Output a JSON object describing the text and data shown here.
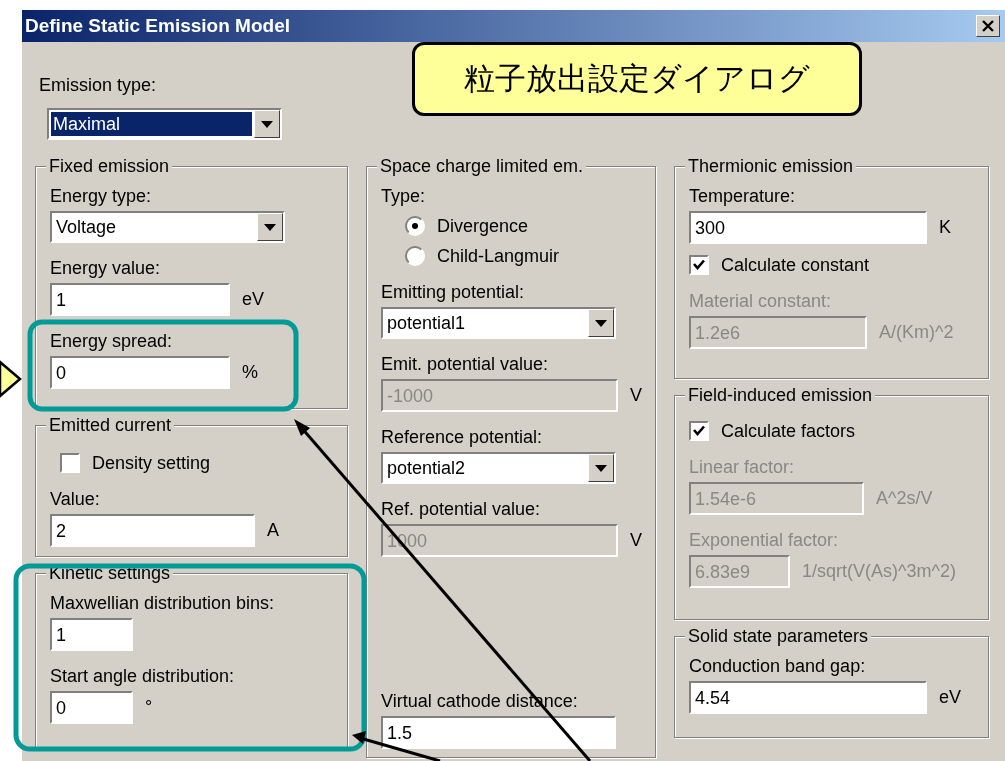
{
  "window": {
    "title": "Define Static Emission Model"
  },
  "emission_type": {
    "label": "Emission type:",
    "value": "Maximal",
    "highlighted": true
  },
  "columns": [
    [
      {
        "title": "Fixed emission",
        "items": [
          {
            "kind": "label",
            "text": "Energy type:",
            "disabled": false
          },
          {
            "kind": "select",
            "value": "Voltage",
            "highlighted": false
          },
          {
            "kind": "label",
            "text": "Energy value:",
            "disabled": false
          },
          {
            "kind": "input",
            "value": "1",
            "disabled": false,
            "unit": {
              "text": "eV",
              "disabled": false
            }
          },
          {
            "kind": "label",
            "text": "Energy spread:",
            "disabled": false
          },
          {
            "kind": "input",
            "value": "0",
            "disabled": false,
            "unit": {
              "text": "%",
              "disabled": false
            }
          }
        ]
      },
      {
        "title": "Emitted current",
        "items": [
          {
            "kind": "checkbox",
            "label": "Density setting",
            "checked": false
          },
          {
            "kind": "label",
            "text": "Value:",
            "disabled": false
          },
          {
            "kind": "input",
            "value": "2",
            "disabled": false,
            "unit": {
              "text": "A",
              "disabled": false
            }
          }
        ]
      },
      {
        "title": "Kinetic settings",
        "items": [
          {
            "kind": "label",
            "text": "Maxwellian distribution bins:",
            "disabled": false
          },
          {
            "kind": "input",
            "value": "1",
            "disabled": false
          },
          {
            "kind": "label",
            "text": "Start angle distribution:",
            "disabled": false
          },
          {
            "kind": "input",
            "value": "0",
            "disabled": false,
            "unit": {
              "text": "°",
              "disabled": false
            }
          }
        ]
      }
    ],
    [
      {
        "title": "Space charge limited em.",
        "items": [
          {
            "kind": "label",
            "text": "Type:",
            "disabled": false
          },
          {
            "kind": "radio",
            "label": "Divergence",
            "selected": true
          },
          {
            "kind": "radio",
            "label": "Child-Langmuir",
            "selected": false
          },
          {
            "kind": "label",
            "text": "Emitting potential:",
            "disabled": false
          },
          {
            "kind": "select",
            "value": "potential1",
            "highlighted": false
          },
          {
            "kind": "label",
            "text": "Emit. potential value:",
            "disabled": false
          },
          {
            "kind": "input",
            "value": "-1000",
            "disabled": true,
            "unit": {
              "text": "V",
              "disabled": false
            }
          },
          {
            "kind": "label",
            "text": "Reference potential:",
            "disabled": false
          },
          {
            "kind": "select",
            "value": "potential2",
            "highlighted": false
          },
          {
            "kind": "label",
            "text": "Ref. potential value:",
            "disabled": false
          },
          {
            "kind": "input",
            "value": "1000",
            "disabled": true,
            "unit": {
              "text": "V",
              "disabled": false
            }
          },
          {
            "kind": "label",
            "text": "Virtual cathode distance:",
            "disabled": false
          },
          {
            "kind": "input",
            "value": "1.5",
            "disabled": false
          }
        ]
      }
    ],
    [
      {
        "title": "Thermionic emission",
        "items": [
          {
            "kind": "label",
            "text": "Temperature:",
            "disabled": false
          },
          {
            "kind": "input",
            "value": "300",
            "disabled": false,
            "unit": {
              "text": "K",
              "disabled": false
            }
          },
          {
            "kind": "checkbox",
            "label": "Calculate constant",
            "checked": true
          },
          {
            "kind": "label",
            "text": "Material constant:",
            "disabled": true
          },
          {
            "kind": "input",
            "value": "1.2e6",
            "disabled": true,
            "unit": {
              "text": "A/(Km)^2",
              "disabled": true
            }
          }
        ]
      },
      {
        "title": "Field-induced emission",
        "items": [
          {
            "kind": "checkbox",
            "label": "Calculate factors",
            "checked": true
          },
          {
            "kind": "label",
            "text": "Linear factor:",
            "disabled": true
          },
          {
            "kind": "input",
            "value": "1.54e-6",
            "disabled": true,
            "unit": {
              "text": "A^2s/V",
              "disabled": true
            }
          },
          {
            "kind": "label",
            "text": "Exponential factor:",
            "disabled": true
          },
          {
            "kind": "input",
            "value": "6.83e9",
            "disabled": true,
            "unit": {
              "text": "1/sqrt(V(As)^3m^2)",
              "disabled": true
            }
          }
        ]
      },
      {
        "title": "Solid state parameters",
        "items": [
          {
            "kind": "label",
            "text": "Conduction band gap:",
            "disabled": false
          },
          {
            "kind": "input",
            "value": "4.54",
            "disabled": false,
            "unit": {
              "text": "eV",
              "disabled": false
            }
          }
        ]
      }
    ]
  ],
  "callout": {
    "text": "粒子放出設定ダイアログ"
  }
}
